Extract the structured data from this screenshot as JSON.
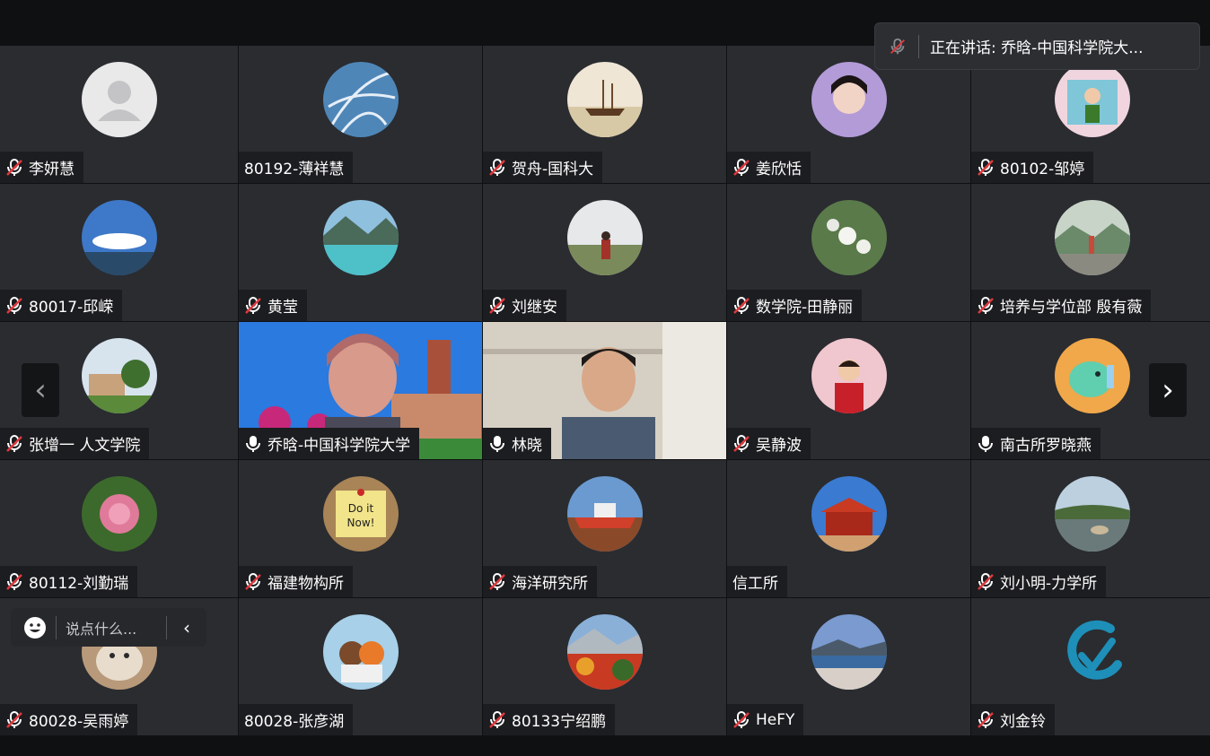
{
  "speaking_banner": {
    "label": "正在讲话: 乔晗-中国科学院大..."
  },
  "chat": {
    "placeholder": "说点什么..."
  },
  "nav": {
    "prev": "‹",
    "next": "›",
    "collapse": "‹"
  },
  "participants": [
    {
      "name": "李妍慧",
      "muted": true,
      "avatar": "default-person"
    },
    {
      "name": "80192-薄祥慧",
      "muted": null,
      "avatar": "feathers-blue"
    },
    {
      "name": "贺舟-国科大",
      "muted": true,
      "avatar": "ship-model"
    },
    {
      "name": "姜欣恬",
      "muted": true,
      "avatar": "girl-portrait"
    },
    {
      "name": "80102-邹婷",
      "muted": true,
      "avatar": "child-photo"
    },
    {
      "name": "80017-邱嵘",
      "muted": true,
      "avatar": "sky-clouds"
    },
    {
      "name": "黄莹",
      "muted": true,
      "avatar": "lake-mountains"
    },
    {
      "name": "刘继安",
      "muted": true,
      "avatar": "field-person"
    },
    {
      "name": "数学院-田静丽",
      "muted": true,
      "avatar": "white-flowers"
    },
    {
      "name": "培养与学位部 殷有薇",
      "muted": true,
      "avatar": "mountain-people"
    },
    {
      "name": "张增一 人文学院",
      "muted": true,
      "avatar": "garden-house"
    },
    {
      "name": "乔晗-中国科学院大学",
      "muted": false,
      "video": "woman-campus",
      "active": true
    },
    {
      "name": "林晓",
      "muted": false,
      "video": "man-office"
    },
    {
      "name": "吴静波",
      "muted": true,
      "avatar": "woman-flowers"
    },
    {
      "name": "南古所罗晓燕",
      "muted": false,
      "avatar": "cartoon-elephant"
    },
    {
      "name": "80112-刘勤瑞",
      "muted": true,
      "avatar": "peony"
    },
    {
      "name": "福建物构所",
      "muted": true,
      "avatar": "do-it-now-note"
    },
    {
      "name": "海洋研究所",
      "muted": true,
      "avatar": "research-ship"
    },
    {
      "name": "信工所",
      "muted": null,
      "avatar": "palace"
    },
    {
      "name": "刘小明-力学所",
      "muted": true,
      "avatar": "river-rocks"
    },
    {
      "name": "80028-吴雨婷",
      "muted": true,
      "avatar": "cat-closeup"
    },
    {
      "name": "80028-张彦湖",
      "muted": null,
      "avatar": "plush-toys"
    },
    {
      "name": "80133宁绍鹏",
      "muted": true,
      "avatar": "autumn-trees"
    },
    {
      "name": "HeFY",
      "muted": true,
      "avatar": "coastal-city"
    },
    {
      "name": "刘金铃",
      "muted": true,
      "avatar": "logo-swirl"
    }
  ],
  "colors": {
    "active_border": "#1fbf6a",
    "tile_bg": "#2a2c30",
    "nameplate_bg": "#1c1d20",
    "muted_red": "#e0393e"
  }
}
